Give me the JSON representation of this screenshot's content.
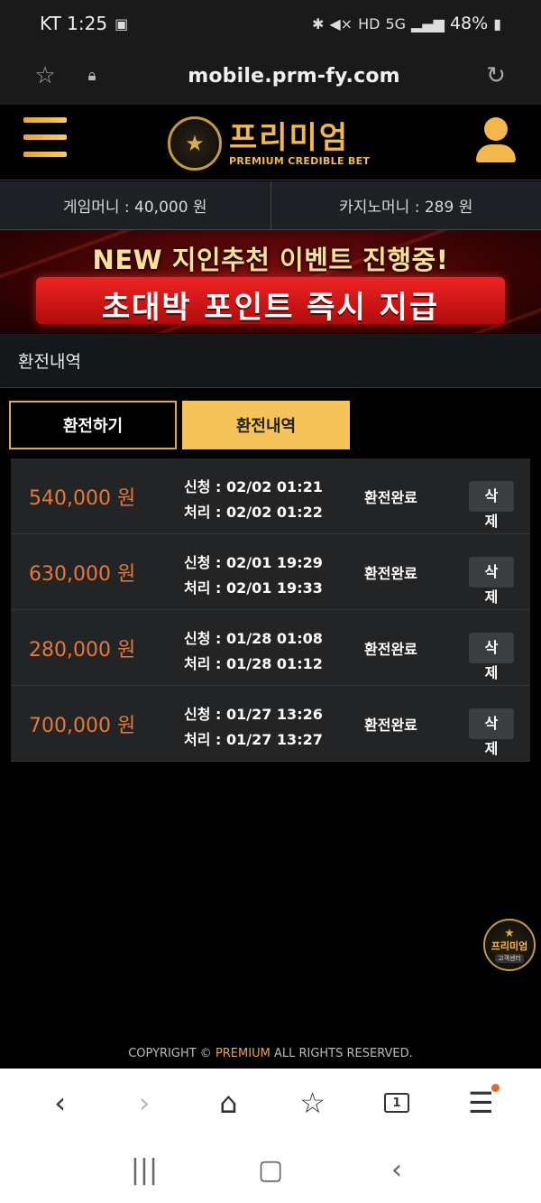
{
  "status_bar": {
    "carrier_time": "KT 1:25",
    "battery": "48%",
    "icons": [
      "image-icon",
      "bluetooth-icon",
      "mute-icon",
      "hd-icon",
      "5g-icon",
      "signal-icon",
      "battery-icon"
    ]
  },
  "browser": {
    "url": "mobile.prm-fy.com"
  },
  "header": {
    "logo_main": "프리미엄",
    "logo_sub": "PREMIUM CREDIBLE BET"
  },
  "money": {
    "game_money": "게임머니 : 40,000 원",
    "casino_money": "카지노머니 : 289 원"
  },
  "banner": {
    "line1": "NEW 지인추천 이벤트 진행중!",
    "line2": "초대박 포인트 즉시 지급"
  },
  "section_title": "환전내역",
  "tabs": {
    "exchange": "환전하기",
    "history": "환전내역"
  },
  "history": [
    {
      "amount": "540,000 원",
      "request": "신청 : 02/02 01:21",
      "process": "처리 : 02/02 01:22",
      "status": "환전완료",
      "delete_1": "삭",
      "delete_2": "제"
    },
    {
      "amount": "630,000 원",
      "request": "신청 : 02/01 19:29",
      "process": "처리 : 02/01 19:33",
      "status": "환전완료",
      "delete_1": "삭",
      "delete_2": "제"
    },
    {
      "amount": "280,000 원",
      "request": "신청 : 01/28 01:08",
      "process": "처리 : 01/28 01:12",
      "status": "환전완료",
      "delete_1": "삭",
      "delete_2": "제"
    },
    {
      "amount": "700,000 원",
      "request": "신청 : 01/27 13:26",
      "process": "처리 : 01/27 13:27",
      "status": "환전완료",
      "delete_1": "삭",
      "delete_2": "제"
    }
  ],
  "cs_badge": {
    "name": "프리미엄",
    "label": "고객센터"
  },
  "copyright": {
    "prefix": "COPYRIGHT © ",
    "brand": "PREMIUM",
    "suffix": " ALL RIGHTS RESERVED."
  },
  "browser_nav": {
    "tabs_count": "1"
  },
  "colors": {
    "accent_gold": "#f6c25a",
    "amount_orange": "#e8773a"
  }
}
